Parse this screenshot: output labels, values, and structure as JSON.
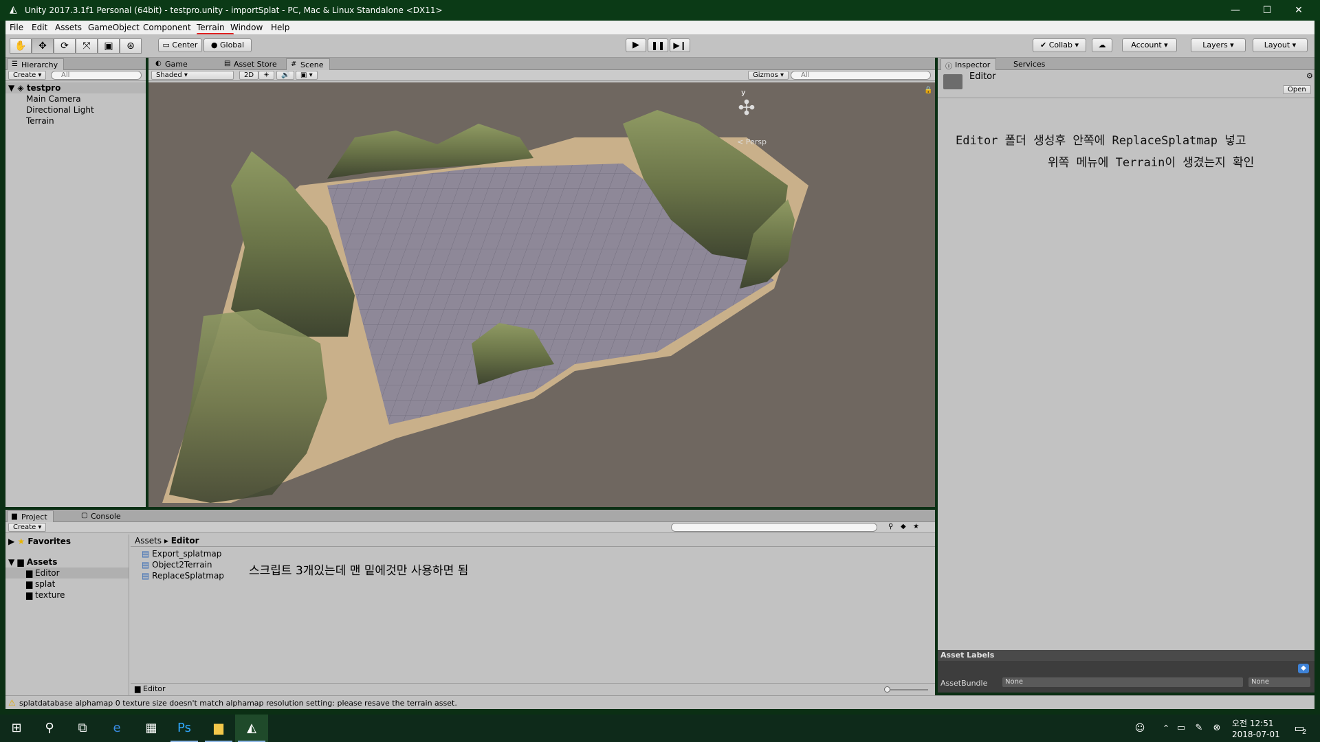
{
  "window": {
    "title": "Unity 2017.3.1f1 Personal (64bit) - testpro.unity - importSplat - PC, Mac & Linux Standalone <DX11>",
    "controls": [
      "—",
      "☐",
      "✕"
    ]
  },
  "menu": {
    "items": [
      "File",
      "Edit",
      "Assets",
      "GameObject",
      "Component",
      "Terrain",
      "Window",
      "Help"
    ]
  },
  "toolbar": {
    "pivot": "Center",
    "space": "Global",
    "collab": "Collab",
    "account": "Account",
    "layers": "Layers",
    "layout": "Layout"
  },
  "hierarchy": {
    "tab": "Hierarchy",
    "create": "Create",
    "search_placeholder": "All",
    "scene": "testpro",
    "items": [
      "Main Camera",
      "Directional Light",
      "Terrain"
    ]
  },
  "scene_view": {
    "tabs": [
      "Game",
      "Asset Store",
      "Scene"
    ],
    "shading": "Shaded",
    "mode_2d": "2D",
    "gizmos": "Gizmos",
    "search_placeholder": "All",
    "gizmo_axis": "y",
    "persp_label": "< Persp"
  },
  "inspector": {
    "tabs": [
      "Inspector",
      "Services"
    ],
    "object_name": "Editor",
    "open_button": "Open",
    "note_line1": "Editor 폴더 생성후 안쪽에 ReplaceSplatmap 넣고",
    "note_line2": "위쪽 메뉴에 Terrain이 생겼는지 확인",
    "asset_labels": "Asset Labels",
    "asset_bundle_label": "AssetBundle",
    "asset_bundle_value": "None",
    "asset_bundle_variant": "None"
  },
  "project": {
    "tabs": [
      "Project",
      "Console"
    ],
    "create": "Create",
    "favorites": "Favorites",
    "assets": "Assets",
    "folders": [
      "Editor",
      "splat",
      "texture"
    ],
    "breadcrumb": [
      "Assets",
      "Editor"
    ],
    "files": [
      "Export_splatmap",
      "Object2Terrain",
      "ReplaceSplatmap"
    ],
    "note": "스크립트 3개있는데 맨 밑에것만 사용하면 됨",
    "footer_path": "Editor"
  },
  "status": {
    "message": "splatdatabase alphamap 0 texture size doesn't match alphamap resolution setting: please resave the terrain asset."
  },
  "taskbar": {
    "time": "오전 12:51",
    "date": "2018-07-01",
    "notification_count": "2"
  },
  "colors": {
    "accent_red": "#e02020",
    "panel_gray": "#c2c2c2",
    "scene_bg": "#6f6760"
  }
}
